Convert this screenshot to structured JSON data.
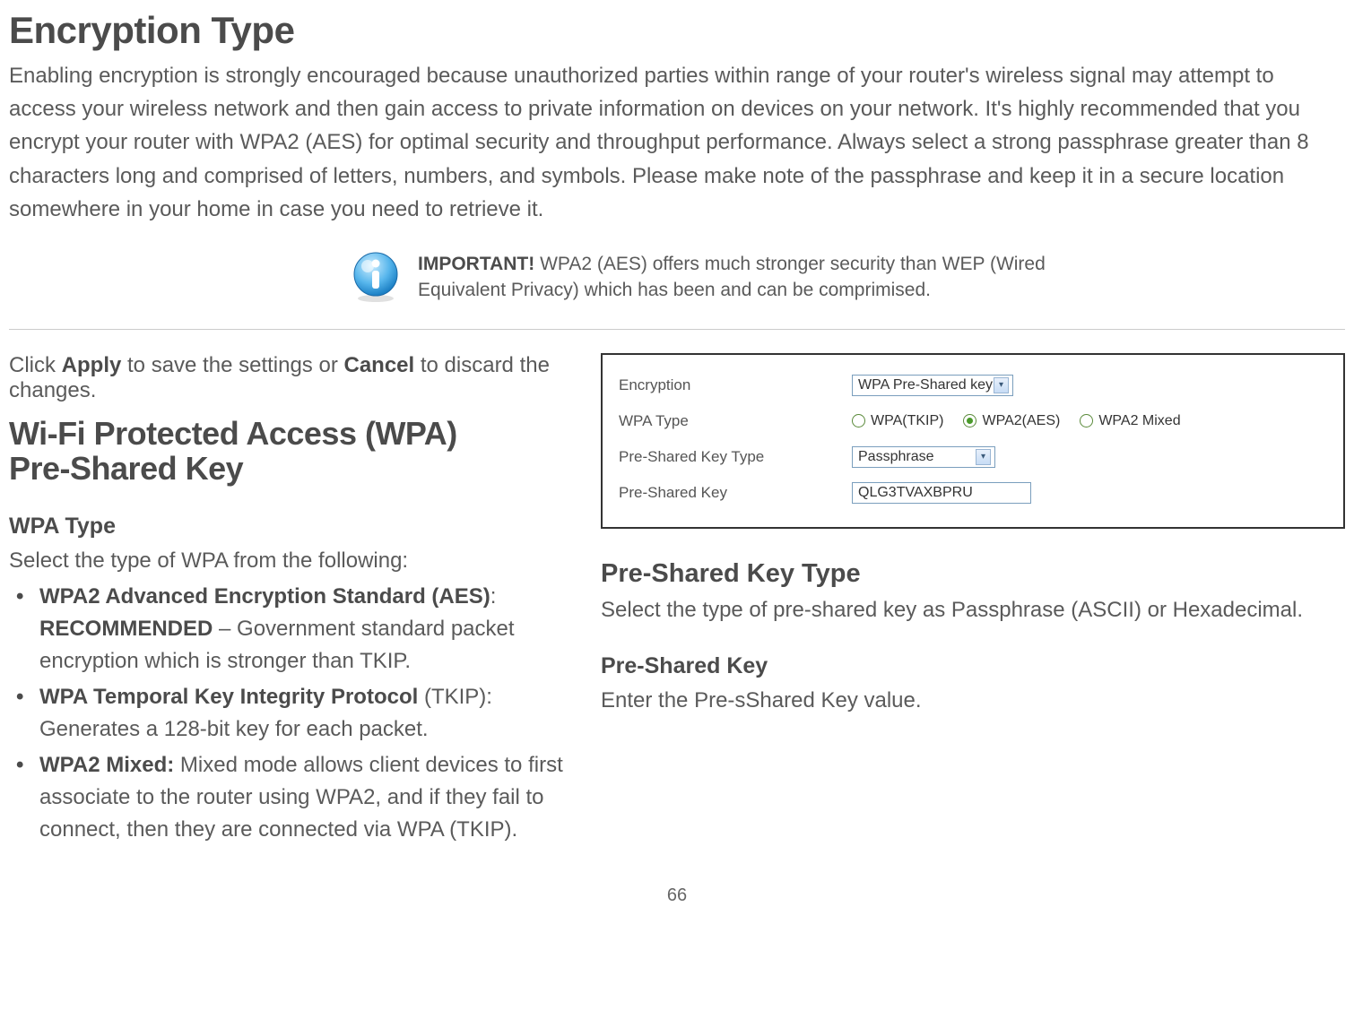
{
  "title": "Encryption Type",
  "intro": "Enabling encryption is strongly encouraged because unauthorized parties within range of your router's wireless signal may attempt to access your wireless network and then gain access to private information on devices on your network. It's highly recommended that you encrypt your router with WPA2 (AES) for optimal security and throughput performance. Always select a strong passphrase greater than 8 characters long and comprised of letters, numbers, and symbols. Please make note of the passphrase and keep it in a secure location somewhere in your home in case you need to retrieve it.",
  "important": {
    "label": "IMPORTANT!",
    "text": " WPA2 (AES) offers much stronger security than WEP (Wired Equivalent Privacy) which has been and can be comprimised."
  },
  "clickline": {
    "pre": "Click ",
    "apply": "Apply",
    "mid": " to save the settings or ",
    "cancel": "Cancel",
    "post": " to discard the changes."
  },
  "section_title_l1": "Wi-Fi Protected Access (WPA)",
  "section_title_l2": "Pre-Shared Key",
  "wpa_type": {
    "heading": "WPA Type",
    "intro": "Select the type of WPA from the following:",
    "items": {
      "aes_b1": "WPA2 Advanced Encryption Standard (AES)",
      "aes_colon": ": ",
      "aes_b2": "RECOMMENDED",
      "aes_rest": " – Government standard packet encryption which is stronger than TKIP.",
      "tkip_b": "WPA Temporal Key Integrity Protocol",
      "tkip_rest": " (TKIP): Generates a 128-bit key for each packet.",
      "mixed_b": "WPA2 Mixed:",
      "mixed_rest": " Mixed mode allows client devices to first associate to the router using WPA2, and if they fail to connect, then they are connected via WPA (TKIP)."
    }
  },
  "panel": {
    "row_enc_label": "Encryption",
    "row_enc_value": "WPA Pre-Shared key",
    "row_wpa_label": "WPA Type",
    "radio_tkip": "WPA(TKIP)",
    "radio_aes": "WPA2(AES)",
    "radio_mixed": "WPA2 Mixed",
    "row_pskt_label": "Pre-Shared Key Type",
    "row_pskt_value": "Passphrase",
    "row_psk_label": "Pre-Shared Key",
    "row_psk_value": "QLG3TVAXBPRU"
  },
  "psk_type": {
    "heading": "Pre-Shared Key Type",
    "body": "Select the type of pre-shared key as Passphrase (ASCII) or Hexadecimal."
  },
  "psk": {
    "heading": "Pre-Shared Key",
    "body": "Enter the Pre-sShared Key value."
  },
  "page": "66"
}
